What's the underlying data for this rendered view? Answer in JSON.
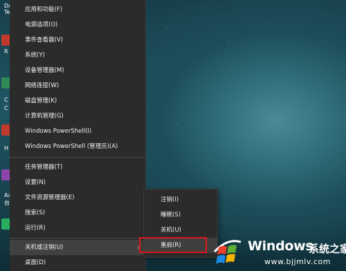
{
  "desktop": {
    "icon_labels": [
      "Da",
      "Te",
      "R",
      "C",
      "C",
      "H",
      "Ax",
      "台"
    ]
  },
  "menu": {
    "group1": [
      "应用和功能(F)",
      "电源选项(O)",
      "事件查看器(V)",
      "系统(Y)",
      "设备管理器(M)",
      "网络连接(W)",
      "磁盘管理(K)",
      "计算机管理(G)",
      "Windows PowerShell(I)",
      "Windows PowerShell (管理员)(A)"
    ],
    "group2": [
      "任务管理器(T)",
      "设置(N)",
      "文件资源管理器(E)",
      "搜索(S)",
      "运行(R)"
    ],
    "group3": [
      "关机或注销(U)",
      "桌面(D)"
    ],
    "submenu_arrow": ">"
  },
  "submenu": {
    "items": [
      "注销(I)",
      "睡眠(S)",
      "关机(U)",
      "重启(R)"
    ]
  },
  "watermark": {
    "title": "Windows",
    "subtitle": "系统之家",
    "url": "www.bjjmlv.com",
    "logo_icon": "windows-logo-icon",
    "colors": {
      "logo_red": "#e8412c",
      "logo_green": "#5fb034",
      "logo_blue": "#1e88e5",
      "logo_yellow": "#f7b500"
    }
  }
}
